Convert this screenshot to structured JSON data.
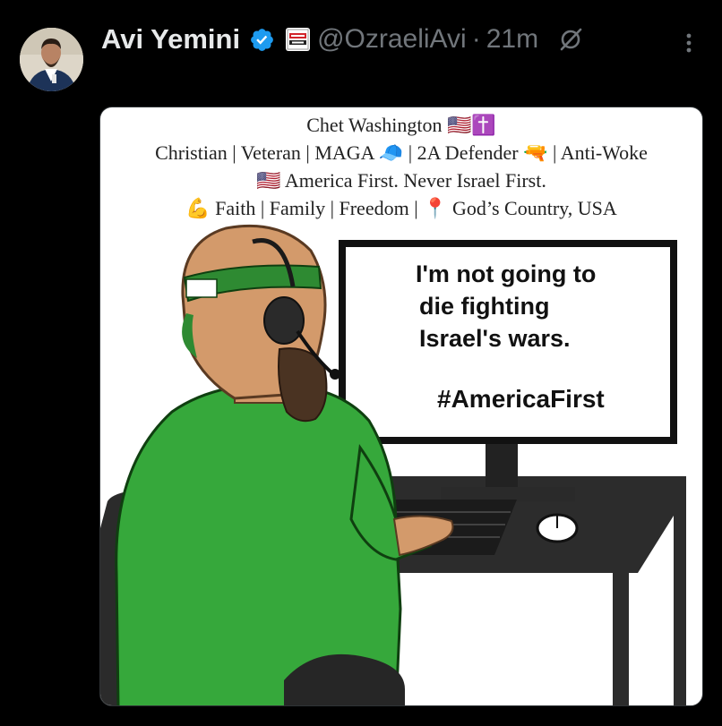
{
  "post": {
    "author_name": "Avi Yemini",
    "handle": "@OzraeliAvi",
    "separator": "·",
    "time": "21m",
    "affiliate_badge_text": "REBEL NEWS"
  },
  "image": {
    "caption_lines": [
      "Chet Washington 🇺🇸✝️",
      "Christian | Veteran | MAGA 🧢 | 2A Defender 🔫 | Anti-Woke",
      "🇺🇸 America First. Never Israel First.",
      "💪 Faith | Family | Freedom | 📍 God’s Country, USA"
    ],
    "monitor_lines": [
      "I'm not going to",
      "die fighting",
      "Israel's wars."
    ],
    "monitor_hashtag": "#AmericaFirst"
  },
  "colors": {
    "background": "#000000",
    "name_text": "#e7e9ea",
    "secondary_text": "#71767b",
    "verified_blue": "#1d9bf0",
    "shirt_green": "#36a83b"
  },
  "icons": {
    "verified": "verified-badge-icon",
    "affiliate": "affiliate-badge-icon",
    "grok": "grok-icon",
    "more": "more-options-icon"
  }
}
